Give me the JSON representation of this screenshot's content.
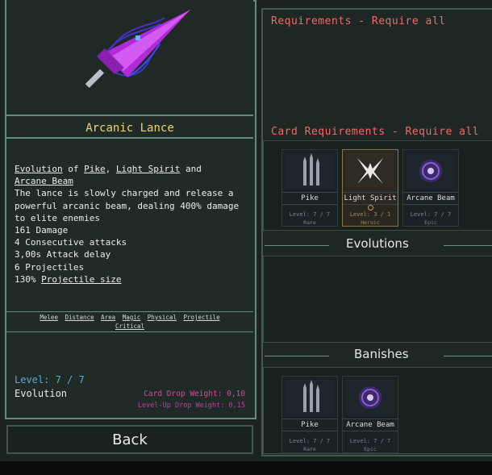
{
  "item": {
    "title": "Arcanic Lance",
    "evolution_prefix": "Evolution",
    "evolution_of": "of",
    "source_a": "Pike",
    "comma": ",",
    "source_b": "Light Spirit",
    "and": "and",
    "source_c": "Arcane Beam",
    "description": "The lance is slowly charged and release a powerful arcanic beam, dealing 400% damage to elite enemies",
    "stats": [
      "161 Damage",
      "4 Consecutive attacks",
      "3,00s Attack delay",
      "6 Projectiles"
    ],
    "stat_size_value": "130%",
    "stat_size_label": "Projectile size",
    "tags": [
      "Melee",
      "Distance",
      "Area",
      "Magic",
      "Physical",
      "Projectile",
      "Critical"
    ],
    "level": "Level: 7 / 7",
    "type": "Evolution",
    "card_drop_weight": "Card Drop Weight: 0,10",
    "levelup_drop_weight": "Level-Up Drop Weight: 0,15"
  },
  "back_label": "Back",
  "requirements_title": "Requirements - Require all",
  "card_requirements_title": "Card Requirements - Require all",
  "card_requirements": [
    {
      "name": "Pike",
      "level": "Level: 7 / 7",
      "rarity": "Rare"
    },
    {
      "name": "Light Spirit",
      "level": "Level: 3 / 1",
      "rarity": "Heroic"
    },
    {
      "name": "Arcane Beam",
      "level": "Level: 7 / 7",
      "rarity": "Epic"
    }
  ],
  "evolutions_title": "Evolutions",
  "banishes_title": "Banishes",
  "banishes": [
    {
      "name": "Pike",
      "level": "Level: 7 / 7",
      "rarity": "Rare"
    },
    {
      "name": "Arcane Beam",
      "level": "Level: 7 / 7",
      "rarity": "Epic"
    }
  ],
  "colors": {
    "accent": "#5f8f7a",
    "title": "#f0d36a",
    "requirement": "#ef6a6a",
    "level": "#5fa8d8",
    "weight": "#d8489f"
  }
}
